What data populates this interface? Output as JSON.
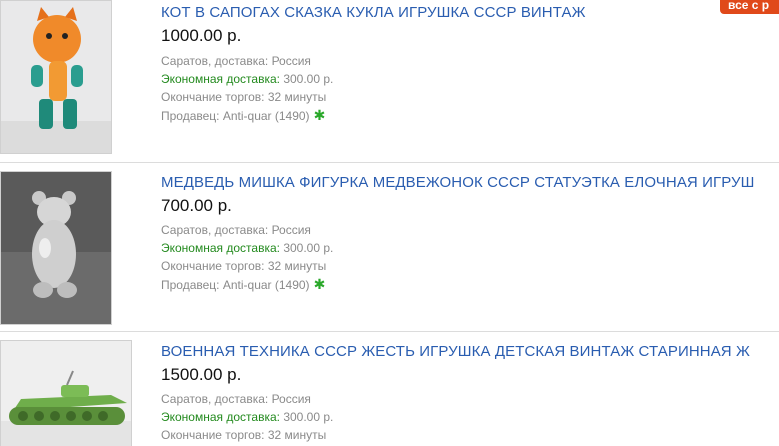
{
  "badge": "все с р",
  "listings": [
    {
      "title": "КОТ В САПОГАХ СКАЗКА КУКЛА ИГРУШКА СССР ВИНТАЖ",
      "price": "1000.00 р.",
      "location": "Саратов, доставка: Россия",
      "shipping_label": "Экономная доставка:",
      "shipping_value": "300.00 р.",
      "ends": "Окончание торгов: 32 минуты",
      "seller": "Продавец: Anti-quar (1490)"
    },
    {
      "title": "МЕДВЕДЬ МИШКА ФИГУРКА МЕДВЕЖОНОК СССР СТАТУЭТКА ЕЛОЧНАЯ ИГРУШ",
      "price": "700.00 р.",
      "location": "Саратов, доставка: Россия",
      "shipping_label": "Экономная доставка:",
      "shipping_value": "300.00 р.",
      "ends": "Окончание торгов: 32 минуты",
      "seller": "Продавец: Anti-quar (1490)"
    },
    {
      "title": "ВОЕННАЯ ТЕХНИКА СССР ЖЕСТЬ ИГРУШКА ДЕТСКАЯ ВИНТАЖ СТАРИННАЯ Ж",
      "price": "1500.00 р.",
      "location": "Саратов, доставка: Россия",
      "shipping_label": "Экономная доставка:",
      "shipping_value": "300.00 р.",
      "ends": "Окончание торгов: 32 минуты"
    }
  ],
  "colors": {
    "link": "#2a5db0",
    "eco": "#238a1e",
    "star": "#2aa82a",
    "badge": "#e0491a"
  },
  "icons": {
    "seller_rating": "green-star-icon"
  }
}
